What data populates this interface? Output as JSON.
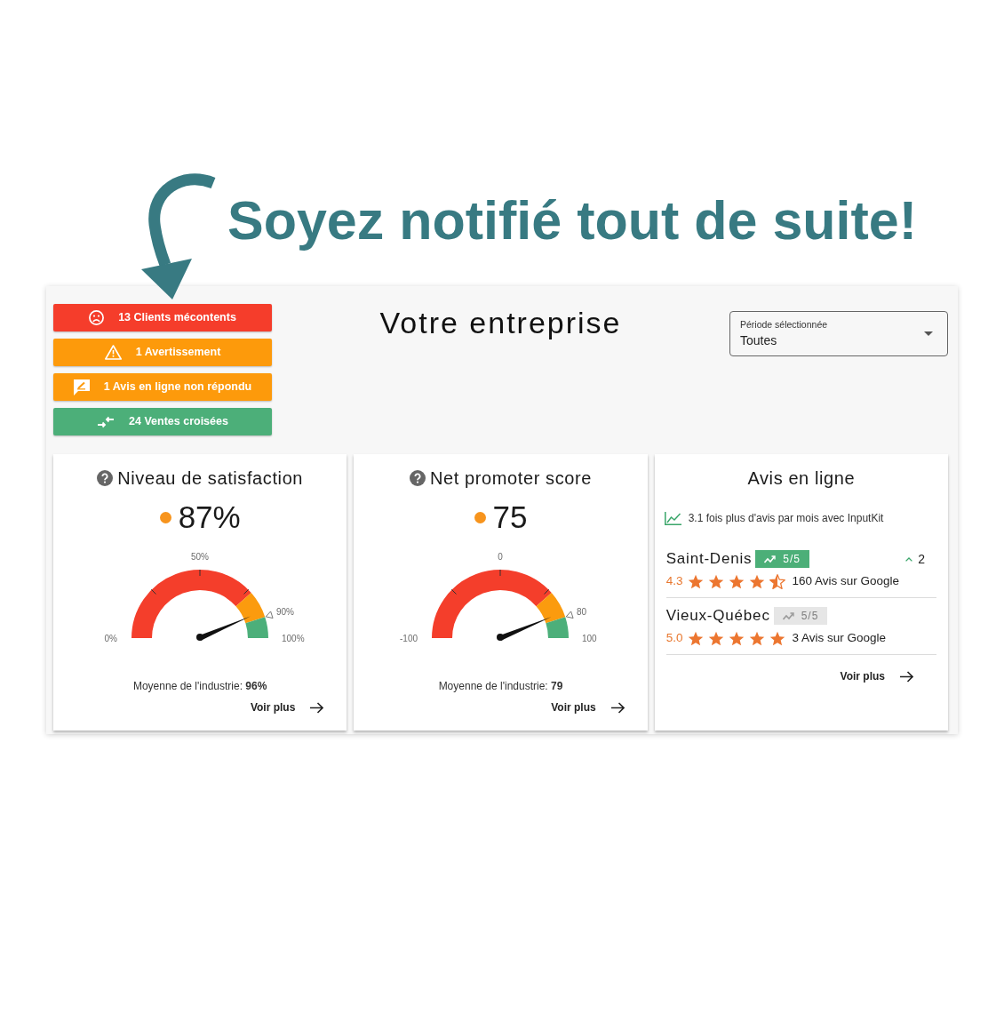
{
  "headline": "Soyez notifié tout de suite!",
  "panel": {
    "alerts": [
      {
        "kind": "unhappy",
        "label": "13 Clients mécontents",
        "color": "#f53d2b"
      },
      {
        "kind": "warning",
        "label": "1 Avertissement",
        "color": "#fd9a0b"
      },
      {
        "kind": "review",
        "label": "1 Avis en ligne non répondu",
        "color": "#fd9a0b"
      },
      {
        "kind": "cross_sell",
        "label": "24 Ventes croisées",
        "color": "#4caf79"
      }
    ],
    "title": "Votre entreprise",
    "period_select": {
      "label": "Période sélectionnée",
      "value": "Toutes"
    },
    "cards": [
      {
        "kind": "gauge",
        "title": "Niveau de satisfaction",
        "score": {
          "value": "87%",
          "color": "#f7941d"
        },
        "gauge": {
          "level": 0.87,
          "min_label": "0%",
          "mid_label": "50%",
          "target_label": "90%",
          "max_label": "100%"
        },
        "industry_average": "Moyenne de l'industrie: **96%**",
        "link": "Voir plus"
      },
      {
        "kind": "gauge",
        "title": "Net promoter score",
        "score": {
          "value": "75",
          "color": "#f7941d"
        },
        "gauge": {
          "level": 0.875,
          "min_label": "-100",
          "mid_label": "0",
          "target_label": "80",
          "max_label": "100"
        },
        "industry_average": "Moyenne de l'industrie: **79**",
        "link": "Voir plus"
      },
      {
        "kind": "reviews",
        "title": "Avis en ligne",
        "tip": "3.1 fois plus d'avis par mois avec InputKit",
        "locations": [
          {
            "name": "Saint-Denis",
            "badge": {
              "text": "5/5",
              "active": true
            },
            "change": "2",
            "rating": "4.3",
            "stars": 4.5,
            "count": "160 Avis sur Google"
          },
          {
            "name": "Vieux-Québec",
            "badge": {
              "text": "5/5",
              "active": false
            },
            "rating": "5.0",
            "stars": 5,
            "count": "3 Avis sur Google"
          }
        ],
        "link": "Voir plus"
      }
    ]
  }
}
